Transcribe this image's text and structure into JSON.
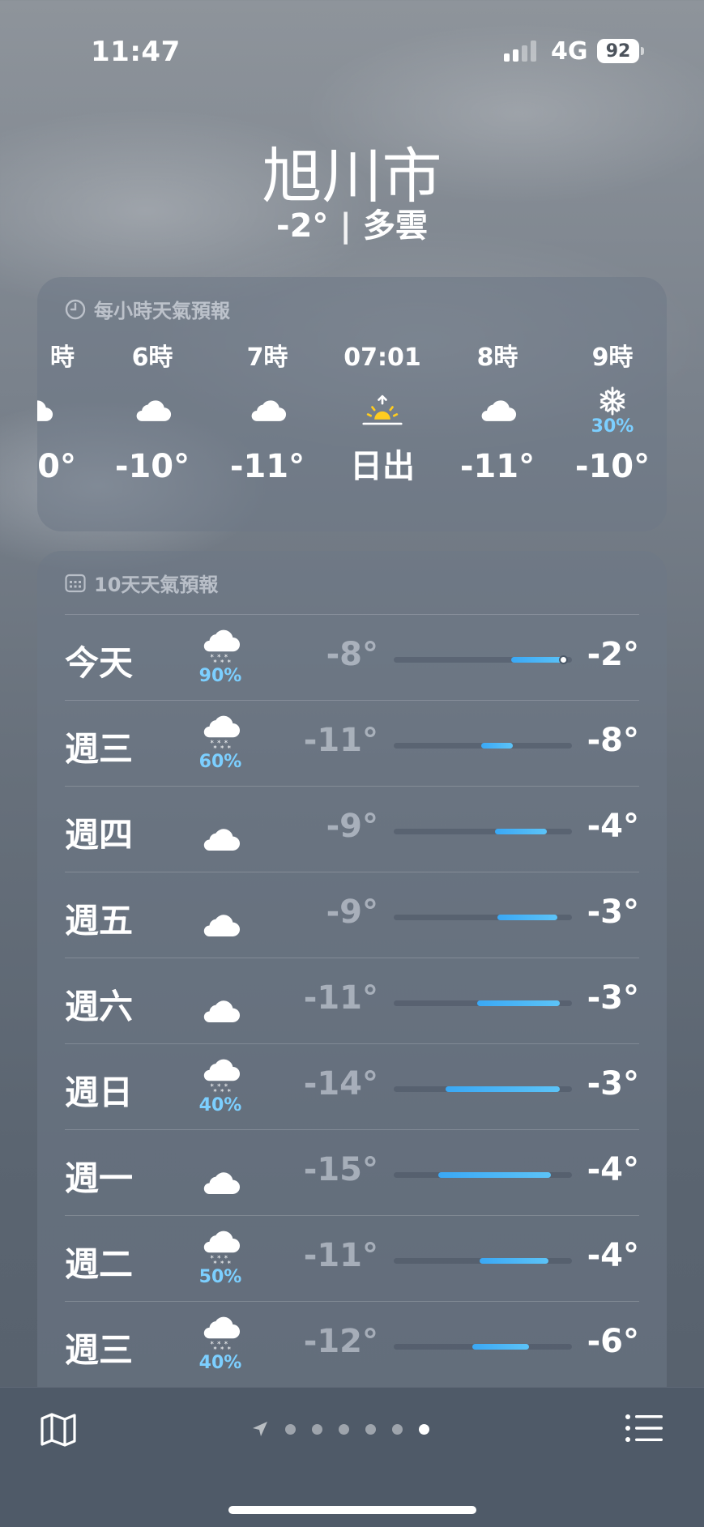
{
  "status_bar": {
    "time": "11:47",
    "network": "4G",
    "battery": "92"
  },
  "location": {
    "city": "旭川市",
    "temp": "-2°",
    "separator": "|",
    "condition": "多雲"
  },
  "hourly": {
    "title": "每小時天氣預報",
    "items": [
      {
        "label": "時",
        "icon": "cloud-icon",
        "precip": "",
        "temp": "0°"
      },
      {
        "label": "6時",
        "icon": "cloud-icon",
        "precip": "",
        "temp": "-10°"
      },
      {
        "label": "7時",
        "icon": "cloud-icon",
        "precip": "",
        "temp": "-11°"
      },
      {
        "label": "07:01",
        "icon": "sunrise-icon",
        "precip": "",
        "temp": "日出"
      },
      {
        "label": "8時",
        "icon": "cloud-icon",
        "precip": "",
        "temp": "-11°"
      },
      {
        "label": "9時",
        "icon": "snowflake-icon",
        "precip": "30%",
        "temp": "-10°"
      }
    ]
  },
  "daily": {
    "title": "10天天氣預報",
    "days": [
      {
        "name": "今天",
        "icon": "snow-cloud-icon",
        "precip": "90%",
        "low": "-8°",
        "high": "-2°",
        "range": [
          0.66,
          0.97
        ],
        "now": 0.95
      },
      {
        "name": "週三",
        "icon": "snow-cloud-icon",
        "precip": "60%",
        "low": "-11°",
        "high": "-8°",
        "range": [
          0.49,
          0.67
        ]
      },
      {
        "name": "週四",
        "icon": "cloud-icon",
        "precip": "",
        "low": "-9°",
        "high": "-4°",
        "range": [
          0.57,
          0.86
        ]
      },
      {
        "name": "週五",
        "icon": "cloud-icon",
        "precip": "",
        "low": "-9°",
        "high": "-3°",
        "range": [
          0.58,
          0.92
        ]
      },
      {
        "name": "週六",
        "icon": "cloud-icon",
        "precip": "",
        "low": "-11°",
        "high": "-3°",
        "range": [
          0.47,
          0.93
        ]
      },
      {
        "name": "週日",
        "icon": "snow-cloud-icon",
        "precip": "40%",
        "low": "-14°",
        "high": "-3°",
        "range": [
          0.29,
          0.93
        ]
      },
      {
        "name": "週一",
        "icon": "cloud-icon",
        "precip": "",
        "low": "-15°",
        "high": "-4°",
        "range": [
          0.25,
          0.88
        ]
      },
      {
        "name": "週二",
        "icon": "cloud-snow-light-icon",
        "precip": "50%",
        "low": "-11°",
        "high": "-4°",
        "range": [
          0.48,
          0.87
        ]
      },
      {
        "name": "週三",
        "icon": "snow-cloud-icon",
        "precip": "40%",
        "low": "-12°",
        "high": "-6°",
        "range": [
          0.44,
          0.76
        ]
      }
    ]
  },
  "toolbar": {
    "pages": 6,
    "active_page": 6,
    "icons": [
      "map-icon",
      "location-arrow-icon",
      "list-icon"
    ]
  },
  "colors": {
    "precip": "#7ccfff",
    "range_start": "#3aa8f5",
    "range_end": "#5cc3f7",
    "sunrise": "#ffcc1f"
  }
}
